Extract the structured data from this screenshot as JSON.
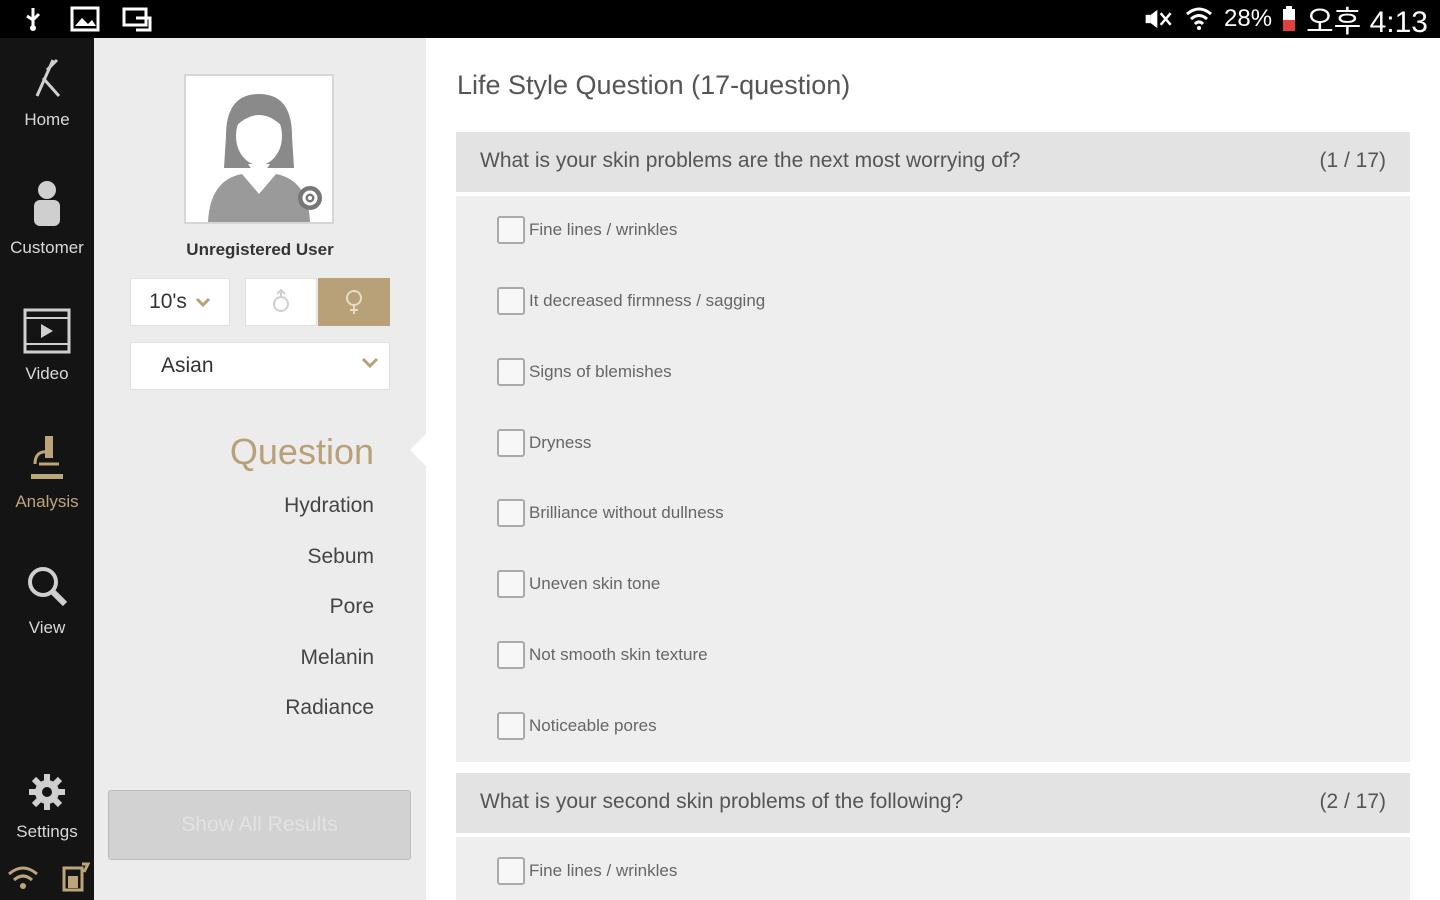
{
  "status_bar": {
    "battery": "28%",
    "time": "오후 4:13",
    "icons": [
      "usb-icon",
      "image-icon",
      "screen-mirror-icon",
      "mute-icon",
      "wifi-icon",
      "battery-icon"
    ]
  },
  "nav": {
    "items": [
      {
        "label": "Home",
        "icon": "home-icon",
        "active": false
      },
      {
        "label": "Customer",
        "icon": "person-icon",
        "active": false
      },
      {
        "label": "Video",
        "icon": "video-icon",
        "active": false
      },
      {
        "label": "Analysis",
        "icon": "microscope-icon",
        "active": true
      },
      {
        "label": "View",
        "icon": "search-icon",
        "active": false
      },
      {
        "label": "Settings",
        "icon": "gear-icon",
        "active": false
      }
    ]
  },
  "profile": {
    "user_name": "Unregistered User",
    "age": "10's",
    "selected_gender": "female",
    "ethnicity": "Asian"
  },
  "menu": {
    "question": "Question",
    "items": [
      "Hydration",
      "Sebum",
      "Pore",
      "Melanin",
      "Radiance"
    ],
    "show_all": "Show All Results"
  },
  "main": {
    "title": "Life Style Question  (17-question)",
    "questions": [
      {
        "text": "What is your skin problems are the next most worrying of?",
        "count": "(1 / 17)",
        "options": [
          "Fine lines / wrinkles",
          "It decreased firmness / sagging",
          "Signs of blemishes",
          "Dryness",
          "Brilliance without dullness",
          "Uneven skin tone",
          "Not smooth skin texture",
          "Noticeable pores"
        ]
      },
      {
        "text": "What is your second skin problems of the following?",
        "count": "(2 / 17)",
        "options": [
          "Fine lines / wrinkles"
        ]
      }
    ]
  },
  "colors": {
    "accent": "#b8a078",
    "nav_bg": "#141414",
    "header_bg": "#e3e3e3"
  }
}
